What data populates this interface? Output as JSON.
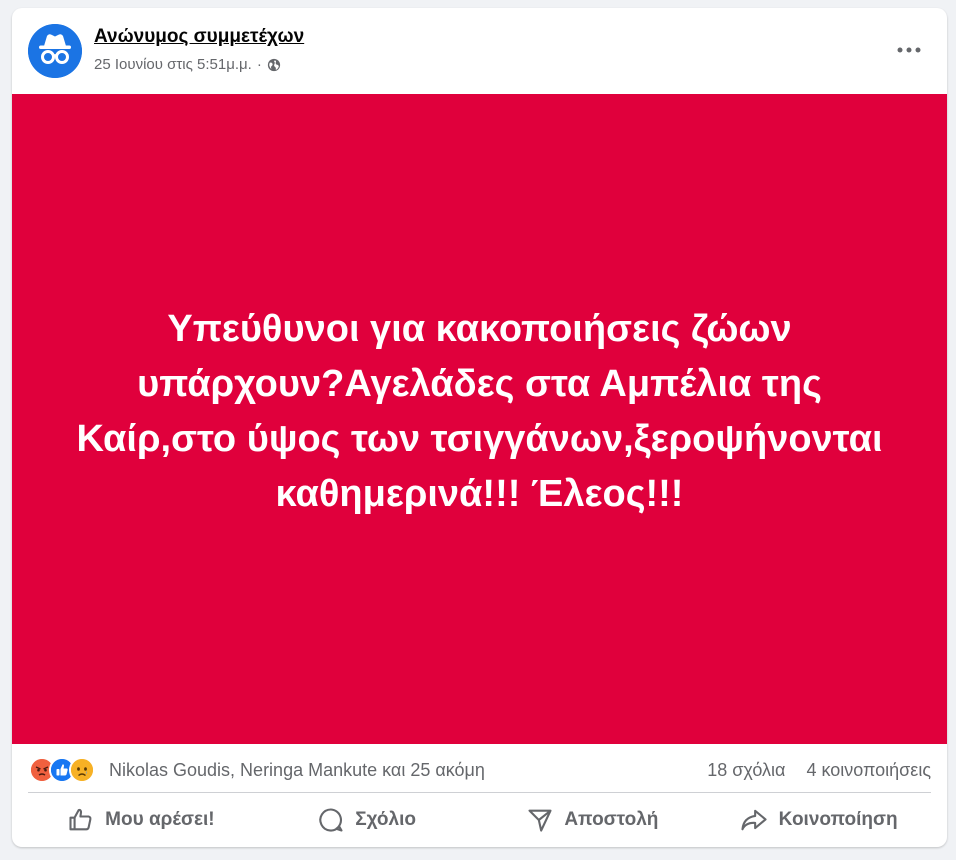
{
  "post": {
    "author": "Ανώνυμος συμμετέχων",
    "timestamp": "25 Ιουνίου στις 5:51μ.μ.",
    "separator": "·",
    "privacy_icon": "globe-icon",
    "avatar_icon": "anonymous-incognito-icon",
    "banner_text": "Υπεύθυνοι για κακοποιήσεις ζώων υπάρχουν?Αγελάδες στα Αμπέλια της Καίρ,στο ύψος των τσιγγάνων,ξεροψήνονται καθημερινά!!! Έλεος!!!",
    "banner_color": "#e0003c"
  },
  "stats": {
    "reactions": [
      "angry",
      "like",
      "sad"
    ],
    "reactors_text": "Nikolas Goudis, Neringa Mankute και 25 ακόμη",
    "comments": "18 σχόλια",
    "shares": "4 κοινοποιήσεις"
  },
  "actions": {
    "like": "Μου αρέσει!",
    "comment": "Σχόλιο",
    "send": "Αποστολή",
    "share": "Κοινοποίηση"
  },
  "colors": {
    "accent": "#1b74e4",
    "secondary_text": "#65676b",
    "angry": "#f0603f",
    "like": "#1877f2",
    "sad": "#f7b125"
  }
}
